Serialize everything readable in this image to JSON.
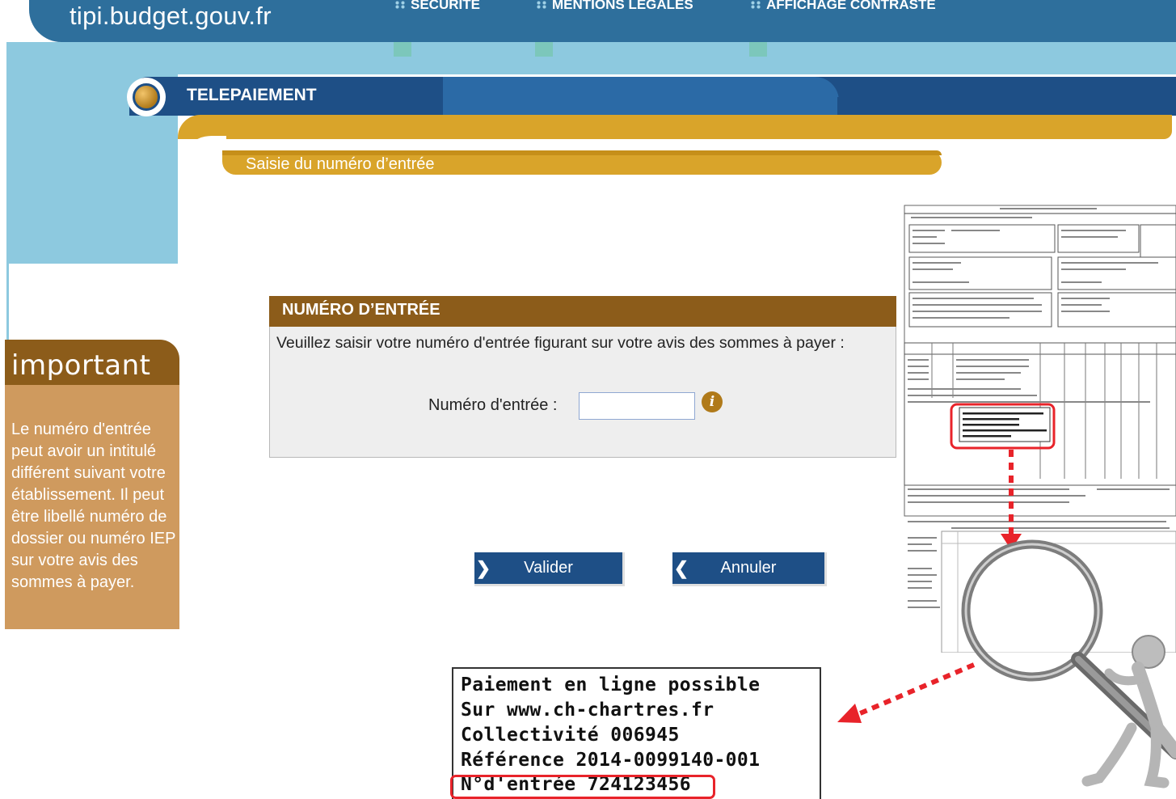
{
  "header": {
    "site_name": "tipi.budget.gouv.fr",
    "links": [
      "SECURITE",
      "MENTIONS LEGALES",
      "AFFICHAGE CONTRASTE"
    ]
  },
  "nav": {
    "title": "TELEPAIEMENT"
  },
  "subheader": {
    "title": "Saisie du numéro d’entrée"
  },
  "important": {
    "title": "important",
    "text": "Le numéro d'entrée peut avoir un intitulé différent suivant votre établissement. Il peut être libellé numéro de dossier ou numéro IEP sur votre avis des sommes à payer."
  },
  "form": {
    "panel_title": "NUMÉRO D’ENTRÉE",
    "instruction": "Veuillez saisir votre numéro d'entrée figurant sur votre avis des sommes à payer :",
    "field_label": "Numéro d'entrée :",
    "field_value": "",
    "info_icon": "info-icon",
    "info_glyph": "i"
  },
  "buttons": {
    "validate": "Valider",
    "cancel": "Annuler",
    "validate_icon": "chevron-right-icon",
    "cancel_icon": "chevron-left-icon"
  },
  "zoom": {
    "line1": "Paiement en ligne possible",
    "line2": "Sur www.ch-chartres.fr",
    "line3": "Collectivité 006945",
    "line4": "Référence 2014-0099140-001",
    "line5": "N°d'entrée 724123456"
  },
  "colors": {
    "header_blue": "#2e6f9c",
    "nav_blue": "#1e4f86",
    "gold": "#d9a42a",
    "brown": "#8c5c1a",
    "tan": "#cf9a5e",
    "highlight_red": "#e8232a"
  }
}
